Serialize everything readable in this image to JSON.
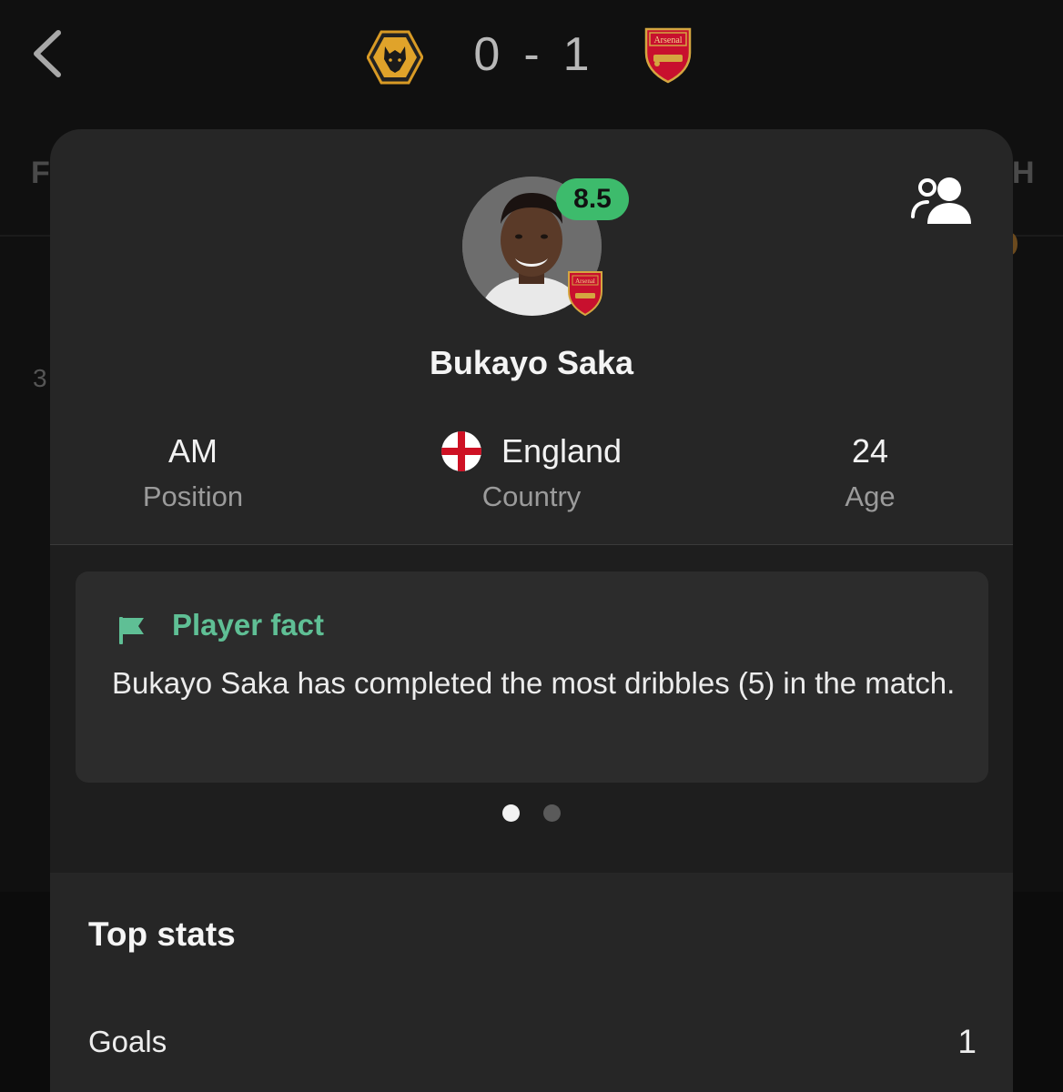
{
  "header": {
    "home_team_icon": "wolves-crest",
    "away_team_icon": "arsenal-crest",
    "home_score": "0",
    "separator": "-",
    "away_score": "1",
    "back_icon": "chevron-left-icon"
  },
  "background": {
    "left_letter": "F",
    "right_letter": "H",
    "left_number": "3"
  },
  "player": {
    "name": "Bukayo Saka",
    "rating": "8.5",
    "rating_color": "#3dbb6c",
    "team_badge_text": "Arsenal",
    "position_value": "AM",
    "position_label": "Position",
    "country_value": "England",
    "country_label": "Country",
    "age_value": "24",
    "age_label": "Age"
  },
  "fact": {
    "title": "Player fact",
    "text": "Bukayo Saka has completed the most dribbles (5) in the match.",
    "accent_color": "#5fbf95"
  },
  "carousel": {
    "pages": 2,
    "active": 1
  },
  "top_stats": {
    "title": "Top stats",
    "rows": [
      {
        "label": "Goals",
        "value": "1"
      }
    ]
  },
  "colors": {
    "background": "#101010",
    "card": "#262626",
    "fact_box": "#2c2c2c"
  }
}
